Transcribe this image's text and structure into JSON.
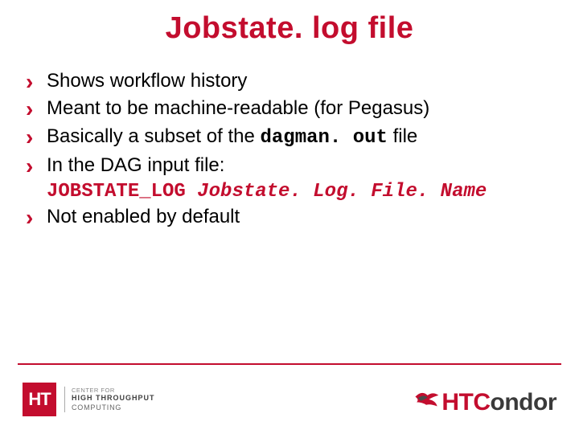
{
  "title": "Jobstate. log file",
  "bullets": {
    "b1": "Shows workflow history",
    "b2": "Meant to be machine-readable (for Pegasus)",
    "b3_pre": "Basically a subset of the ",
    "b3_code": "dagman. out",
    "b3_post": " file",
    "b4": "In the DAG input file:",
    "b4_sub_kw": "JOBSTATE_LOG ",
    "b4_sub_arg": "Jobstate. Log. File. Name",
    "b5": "Not enabled by default"
  },
  "footer": {
    "ht_mark": "HT",
    "ht_line1": "CENTER FOR",
    "ht_line2": "HIGH THROUGHPUT",
    "ht_line3": "COMPUTING",
    "htc_ht": "HTC",
    "htc_ondor": "ondor"
  }
}
